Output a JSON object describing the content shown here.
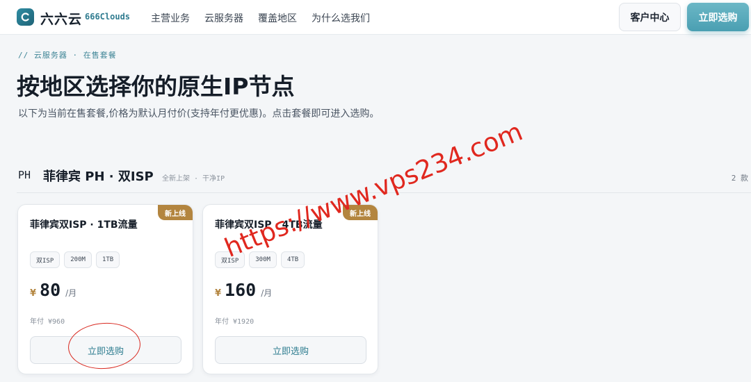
{
  "header": {
    "brand_name": "六六云",
    "brand_sub": "666Clouds",
    "nav": [
      "主营业务",
      "云服务器",
      "覆盖地区",
      "为什么选我们"
    ],
    "console_label": "客户中心",
    "buy_label": "立即选购"
  },
  "intro": {
    "breadcrumb": "// 云服务器 · 在售套餐",
    "title": "按地区选择你的原生IP节点",
    "description": "以下为当前在售套餐,价格为默认月付价(支持年付更优惠)。点击套餐即可进入选购。"
  },
  "section": {
    "code": "PH",
    "title": "菲律宾 PH · 双ISP",
    "tags": "全新上架 · 干净IP",
    "count": "2 款"
  },
  "plans": [
    {
      "badge": "新上线",
      "title": "菲律宾双ISP · 1TB流量",
      "chips": [
        "双ISP",
        "200M",
        "1TB"
      ],
      "currency": "¥",
      "price": "80",
      "unit": "/月",
      "annual": "年付 ¥960",
      "button": "立即选购"
    },
    {
      "badge": "新上线",
      "title": "菲律宾双ISP · 4TB流量",
      "chips": [
        "双ISP",
        "300M",
        "4TB"
      ],
      "currency": "¥",
      "price": "160",
      "unit": "/月",
      "annual": "年付 ¥1920",
      "button": "立即选购"
    }
  ],
  "overlay": {
    "watermark": "https://www.vps234.com",
    "watermark_color": "#e0281f"
  },
  "colors": {
    "accent": "#4a9fb2",
    "badge": "#b3853f"
  }
}
